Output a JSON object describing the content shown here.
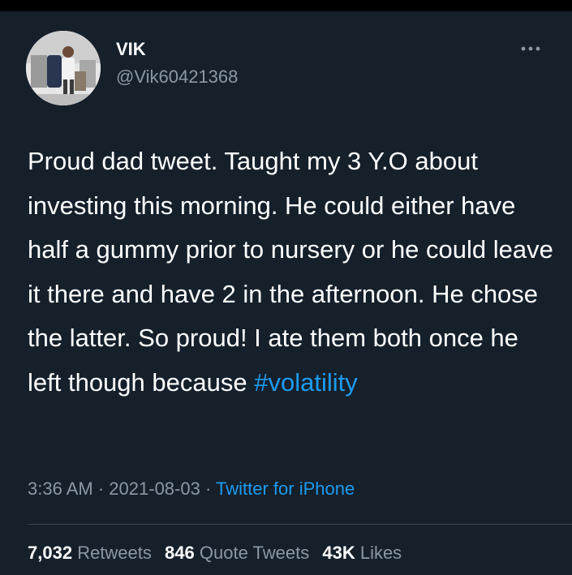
{
  "author": {
    "display_name": "VIK",
    "handle": "@Vik60421368"
  },
  "tweet": {
    "text_before_hashtag": "Proud dad tweet. Taught my 3 Y.O about investing this morning. He could either have half a gummy prior to nursery or he could leave it there and have 2 in the afternoon. He chose the latter. So proud! I ate them both once he left though because ",
    "hashtag": "#volatility"
  },
  "meta": {
    "time": "3:36 AM",
    "separator": "·",
    "date": "2021-08-03",
    "source": "Twitter for iPhone"
  },
  "stats": {
    "retweets_count": "7,032",
    "retweets_label": "Retweets",
    "quote_tweets_count": "846",
    "quote_tweets_label": "Quote Tweets",
    "likes_count": "43K",
    "likes_label": "Likes"
  },
  "colors": {
    "background": "#15202b",
    "text": "#ffffff",
    "secondary_text": "#8b98a5",
    "accent": "#1d9bf0"
  },
  "icons": {
    "more": "more-horizontal-icon",
    "avatar": "profile-photo"
  }
}
